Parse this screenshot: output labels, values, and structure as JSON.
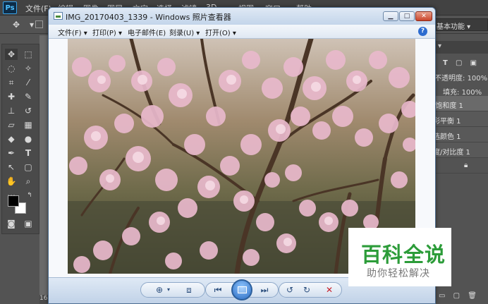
{
  "photoshop": {
    "logo": "Ps",
    "menus": [
      "文件(F)",
      "编辑",
      "图像",
      "图层",
      "文字",
      "选择",
      "滤镜",
      "3D",
      "视图",
      "窗口",
      "帮助"
    ],
    "workspace": "基本功能",
    "panel": {
      "opacity_label": "不透明度:",
      "opacity_value": "100%",
      "fill_label": "填充:",
      "fill_value": "100%",
      "layers": [
        "/饱和度 1",
        "彩平衡 1",
        "选颜色 1",
        "度/对比度 1"
      ]
    },
    "doc_status": "16"
  },
  "viewer": {
    "title": "IMG_20170403_1339 - Windows 照片查看器",
    "menus": [
      "文件(F) ▾",
      "打印(P) ▾",
      "电子邮件(E)",
      "刻录(U) ▾",
      "打开(O) ▾"
    ],
    "help": "?",
    "photo_alt": "blossoming peach trees"
  },
  "watermark": {
    "main": "百科全说",
    "sub": "助你轻松解决"
  },
  "colors": {
    "accent": "#2c9c39",
    "ps_bg": "#535353",
    "viewer_chrome": "#c9d9ea"
  }
}
